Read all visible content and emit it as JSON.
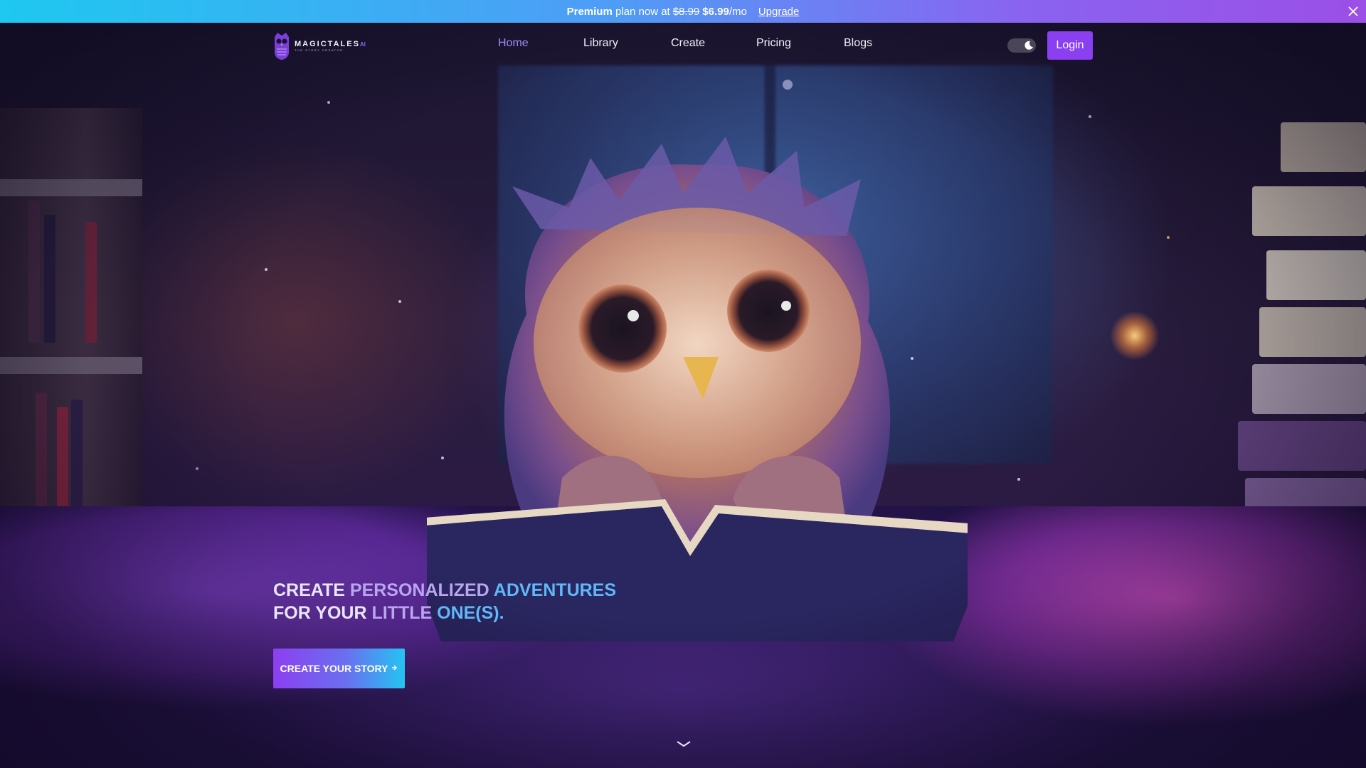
{
  "banner": {
    "plan": "Premium",
    "text": "plan now at",
    "old_price": "$8.99",
    "new_price": "$6.99",
    "period": "/mo",
    "upgrade_label": "Upgrade",
    "close_icon": "close-icon",
    "gradient": [
      "#1ec8f0",
      "#8a63f0",
      "#9b4fe6"
    ]
  },
  "nav": {
    "logo": {
      "name": "MAGICTALES",
      "suffix": "AI",
      "tagline": "THE STORY CREATOR"
    },
    "links": [
      {
        "label": "Home",
        "active": true
      },
      {
        "label": "Library",
        "active": false
      },
      {
        "label": "Create",
        "active": false
      },
      {
        "label": "Pricing",
        "active": false
      },
      {
        "label": "Blogs",
        "active": false
      }
    ],
    "theme_toggle": {
      "state": "dark",
      "icon": "moon-icon"
    },
    "login_label": "Login",
    "accent_color": "#8a3ff0"
  },
  "hero": {
    "headline_line1": [
      "CREATE",
      "PERSONALIZED",
      "ADVENTURES"
    ],
    "headline_line2": [
      "FOR YOUR",
      "LITTLE",
      "ONE(S)."
    ],
    "cta_label": "CREATE YOUR STORY",
    "cta_icon": "arrow-right-icon",
    "scroll_icon": "chevron-down-icon"
  }
}
